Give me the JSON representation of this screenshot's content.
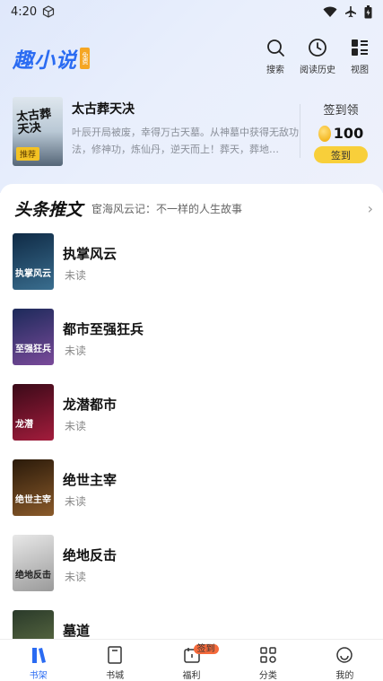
{
  "status_bar": {
    "time": "4:20"
  },
  "header": {
    "logo": "趣小说",
    "logo_badge": "免费",
    "actions": [
      {
        "label": "搜索",
        "icon": "search-icon"
      },
      {
        "label": "阅读历史",
        "icon": "clock-icon"
      },
      {
        "label": "视图",
        "icon": "grid-view-icon"
      }
    ]
  },
  "featured": {
    "cover_text": "太古葬天决",
    "badge": "推荐",
    "title": "太古葬天决",
    "description": "叶辰开局被废，幸得万古天墓。从神墓中获得无敌功法，修神功，炼仙丹，逆天而上！葬天，葬地…",
    "checkin": {
      "title": "签到领",
      "amount": "100",
      "button": "签到"
    }
  },
  "section": {
    "title": "头条推文",
    "subtitle": "宦海风云记：不一样的人生故事",
    "arrow": "›"
  },
  "books": [
    {
      "title": "执掌风云",
      "status": "未读",
      "cover_text": "执掌风云",
      "cover_colors": [
        "#0f2a45",
        "#3a6e8f"
      ]
    },
    {
      "title": "都市至强狂兵",
      "status": "未读",
      "cover_text": "至强狂兵",
      "cover_colors": [
        "#1c2a5a",
        "#7a4a9a"
      ]
    },
    {
      "title": "龙潜都市",
      "status": "未读",
      "cover_text": "龙潜",
      "cover_colors": [
        "#3a0a18",
        "#a31c3c"
      ]
    },
    {
      "title": "绝世主宰",
      "status": "未读",
      "cover_text": "绝世主宰",
      "cover_colors": [
        "#2a1a0a",
        "#8a5a2a"
      ]
    },
    {
      "title": "绝地反击",
      "status": "未读",
      "cover_text": "绝地反击",
      "cover_colors": [
        "#e8e8e8",
        "#9a9a9a"
      ]
    },
    {
      "title": "墓道",
      "status": "",
      "cover_text": "",
      "cover_colors": [
        "#2a3a2a",
        "#6a7a4a"
      ]
    }
  ],
  "bottom_nav": [
    {
      "label": "书架",
      "icon": "bookshelf-icon",
      "active": true
    },
    {
      "label": "书城",
      "icon": "book-icon",
      "active": false
    },
    {
      "label": "福利",
      "icon": "calendar-icon",
      "active": false,
      "badge": "签到"
    },
    {
      "label": "分类",
      "icon": "category-icon",
      "active": false
    },
    {
      "label": "我的",
      "icon": "profile-icon",
      "active": false
    }
  ],
  "colors": {
    "accent": "#2a6bf2",
    "checkin_yellow": "#f8cf3a",
    "badge_orange": "#f56a3b"
  }
}
